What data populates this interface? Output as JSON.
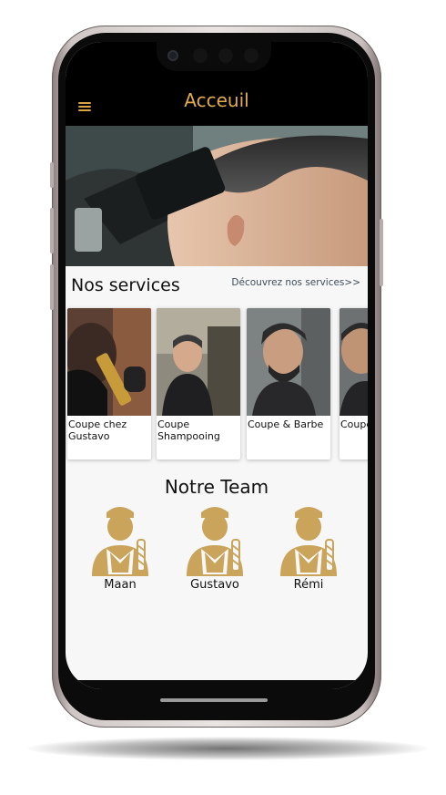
{
  "header": {
    "title": "Acceuil",
    "menu_icon": "hamburger-menu-icon",
    "accent_color": "#e3ad4d"
  },
  "hero": {
    "image": "barber-cutting-hair-photo"
  },
  "services": {
    "heading": "Nos services",
    "link": "Découvrez nos services>>",
    "items": [
      {
        "label": "Coupe chez Gustavo"
      },
      {
        "label": "Coupe Shampooing"
      },
      {
        "label": "Coupe & Barbe"
      },
      {
        "label": "Coupe chez"
      }
    ]
  },
  "team": {
    "heading": "Notre Team",
    "members": [
      {
        "name": "Maan",
        "icon": "barber-avatar-icon"
      },
      {
        "name": "Gustavo",
        "icon": "barber-avatar-icon"
      },
      {
        "name": "Rémi",
        "icon": "barber-avatar-icon"
      }
    ],
    "icon_color": "#c9a45a"
  }
}
